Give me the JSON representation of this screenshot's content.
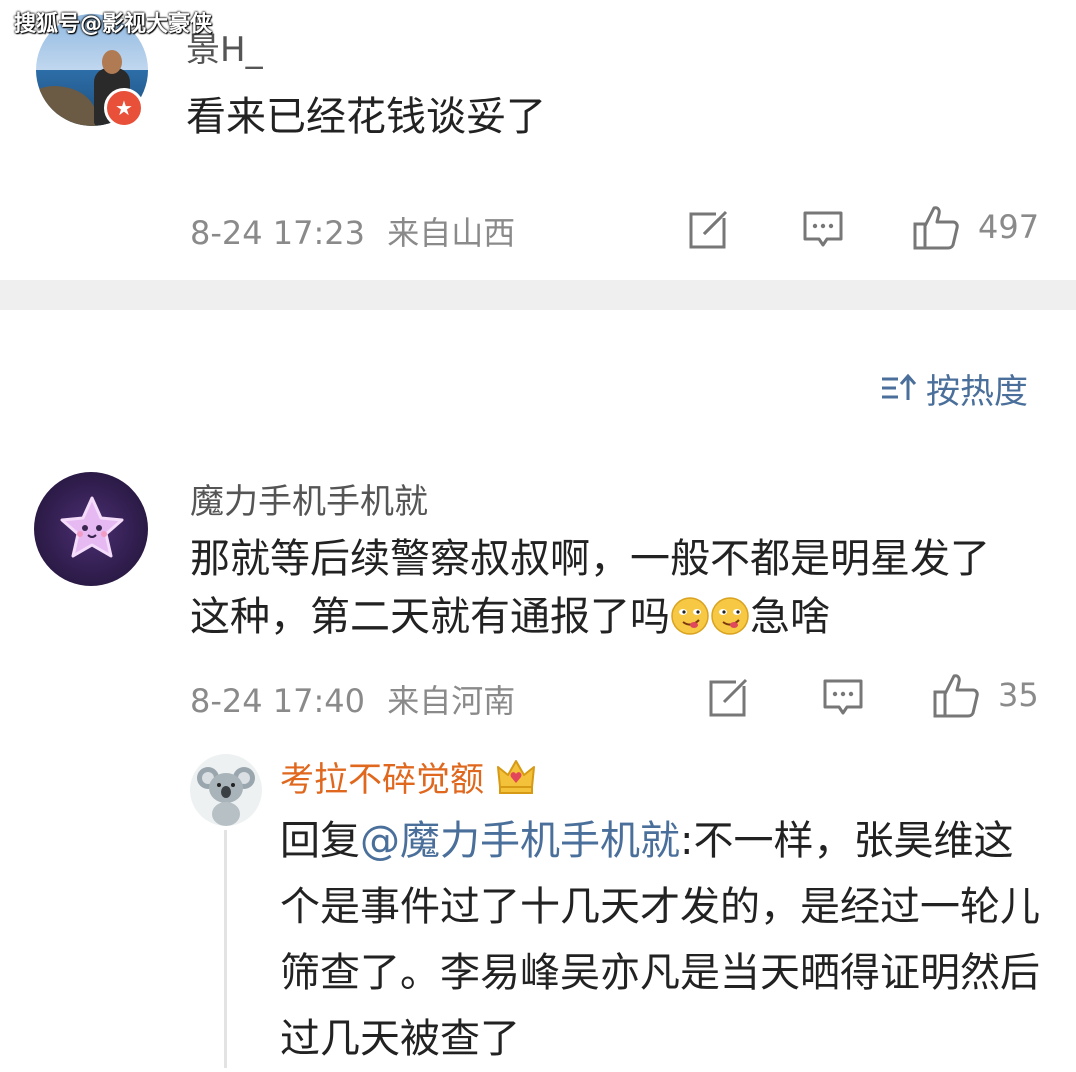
{
  "watermark": "搜狐号@影视大豪侠",
  "comments": [
    {
      "username": "景H_",
      "text": "看来已经花钱谈妥了",
      "date": "8-24 17:23",
      "location": "来自山西",
      "likes": "497"
    },
    {
      "username": "魔力手机手机就",
      "text_before_emoji": "那就等后续警察叔叔啊，一般不都是明星发了这种，第二天就有通报了吗",
      "text_after_emoji": "急啥",
      "date": "8-24 17:40",
      "location": "来自河南",
      "likes": "35"
    }
  ],
  "sort": {
    "label": "按热度"
  },
  "reply": {
    "username": "考拉不碎觉额",
    "prefix": "回复",
    "mention": "@魔力手机手机就",
    "text": ":不一样，张昊维这个是事件过了十几天才发的，是经过一轮儿筛查了。李易峰吴亦凡是当天晒得证明然后过几天被查了"
  },
  "icons": {
    "share": "share-icon",
    "comment": "comment-icon",
    "like": "thumbs-up-icon",
    "sort": "sort-icon",
    "crown": "crown-icon"
  },
  "colors": {
    "link": "#4a6f9a",
    "reply_name": "#e0681e",
    "meta": "#8a8a8a",
    "divider": "#efefef"
  }
}
